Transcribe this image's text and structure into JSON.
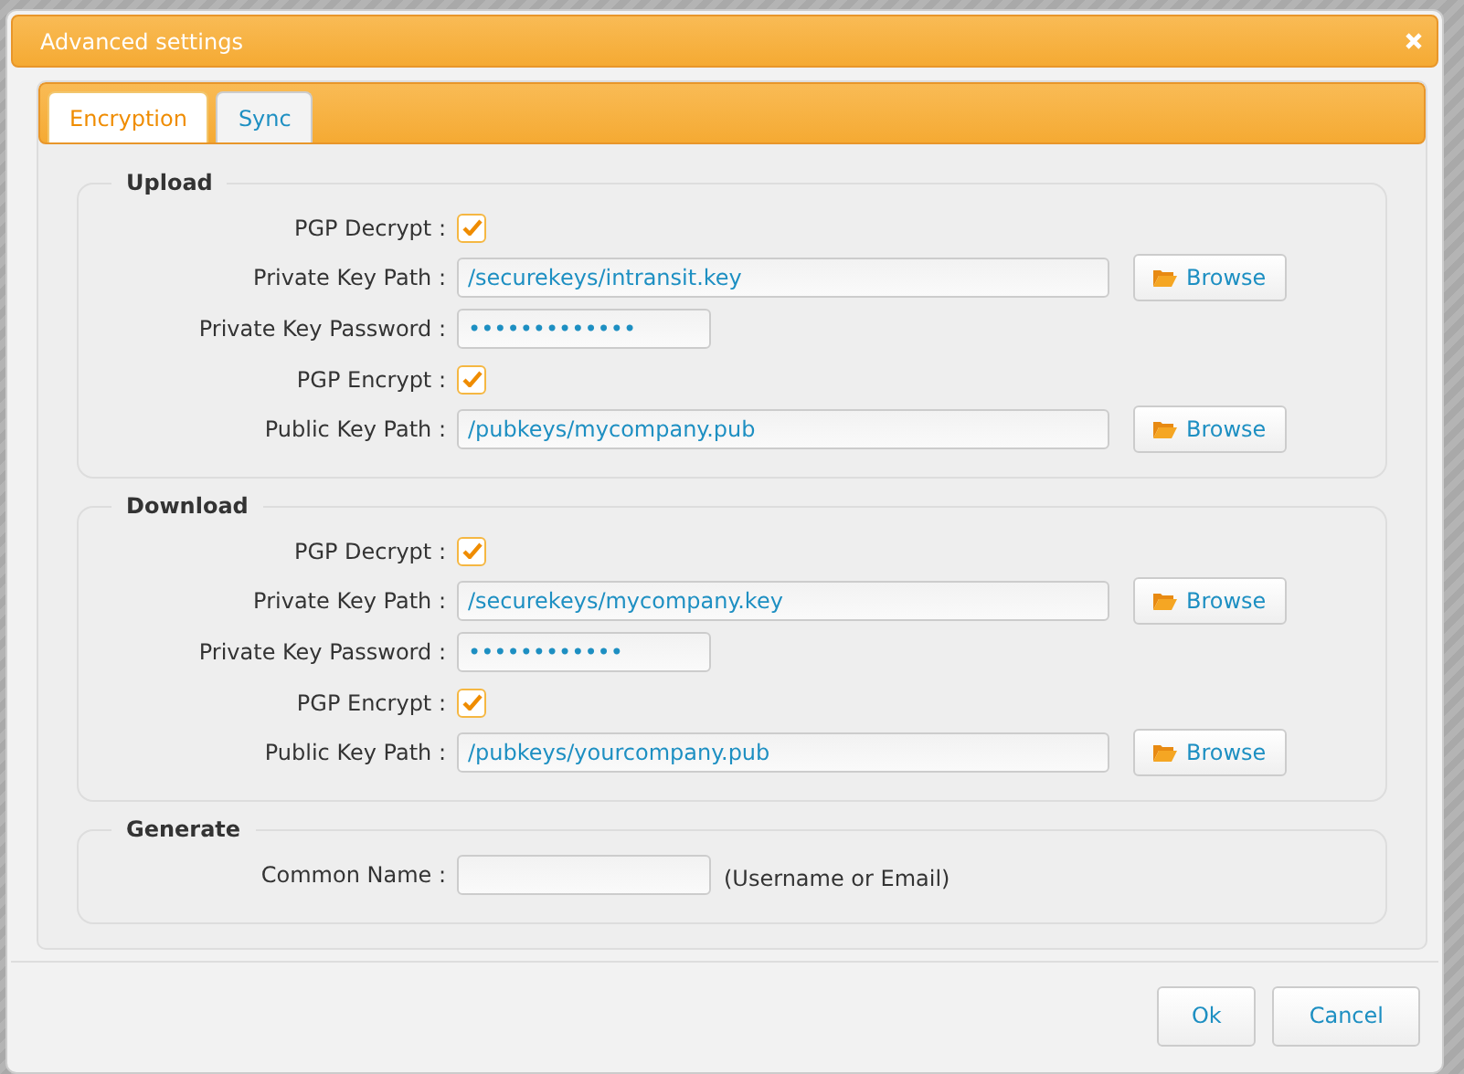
{
  "window": {
    "title": "Advanced settings"
  },
  "tabs": [
    {
      "label": "Encryption",
      "selected": true
    },
    {
      "label": "Sync",
      "selected": false
    }
  ],
  "sections": [
    {
      "title": "Upload",
      "rows": [
        {
          "kind": "checkbox",
          "label": "PGP Decrypt :",
          "checked": true
        },
        {
          "kind": "path",
          "label": "Private Key Path :",
          "value": "/securekeys/intransit.key",
          "button": "Browse"
        },
        {
          "kind": "password",
          "label": "Private Key Password :",
          "value": "•••••••••••••"
        },
        {
          "kind": "checkbox",
          "label": "PGP Encrypt :",
          "checked": true
        },
        {
          "kind": "path",
          "label": "Public Key Path :",
          "value": "/pubkeys/mycompany.pub",
          "button": "Browse"
        }
      ]
    },
    {
      "title": "Download",
      "rows": [
        {
          "kind": "checkbox",
          "label": "PGP Decrypt :",
          "checked": true
        },
        {
          "kind": "path",
          "label": "Private Key Path :",
          "value": "/securekeys/mycompany.key",
          "button": "Browse"
        },
        {
          "kind": "password",
          "label": "Private Key Password :",
          "value": "••••••••••••"
        },
        {
          "kind": "checkbox",
          "label": "PGP Encrypt :",
          "checked": true
        },
        {
          "kind": "path",
          "label": "Public Key Path :",
          "value": "/pubkeys/yourcompany.pub",
          "button": "Browse"
        }
      ]
    },
    {
      "title": "Generate",
      "rows": [
        {
          "kind": "text",
          "label": "Common Name :",
          "value": "",
          "note": "(Username or Email)"
        }
      ]
    }
  ],
  "buttons": [
    "Ok",
    "Cancel"
  ]
}
